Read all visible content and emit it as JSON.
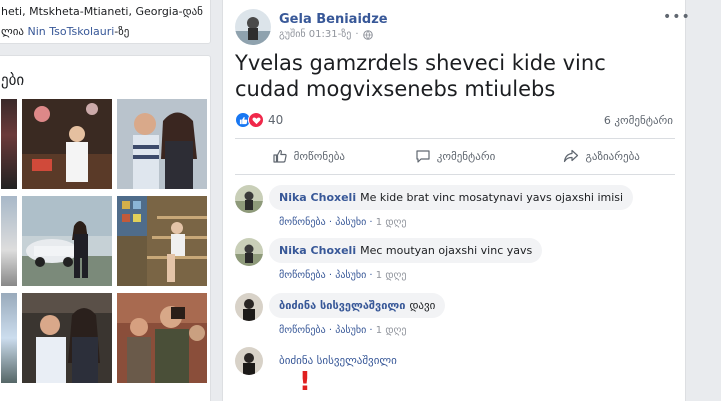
{
  "intro": {
    "line1": "heti, Mtskheta-Mtianeti, Georgia-დან",
    "line2_prefix": "ლია ",
    "line2_link": "Nin TsoTskolauri",
    "line2_suffix": "-ზე"
  },
  "photos": {
    "title": "ები"
  },
  "post": {
    "author": "Gela Beniaidze",
    "time": "გუშინ 01:31-ზე",
    "separator": "·",
    "audience_icon": "globe-icon",
    "more_label": "•••",
    "text": "Yvelas gamzrdels sheveci kide vinc cudad mogvixsenebs mtiulebs",
    "reactions": {
      "icons": [
        "like-icon",
        "love-icon"
      ],
      "count": "40"
    },
    "comments_count": "6 კომენტარი",
    "actions": {
      "like": "მოწონება",
      "comment": "კომენტარი",
      "share": "გაზიარება"
    }
  },
  "comments": [
    {
      "name": "Nika Choxeli",
      "text": "Me kide brat vinc mosatynavi yavs ojaxshi imisi",
      "like": "მოწონება",
      "reply": "პასუხი",
      "time": "1 დღე"
    },
    {
      "name": "Nika Choxeli",
      "text": "Mec moutyan ojaxshi vinc yavs",
      "like": "მოწონება",
      "reply": "პასუხი",
      "time": "1 დღე"
    },
    {
      "name": "ბიძინა სისველაშვილი",
      "text": "დავი",
      "like": "მოწონება",
      "reply": "პასუხი",
      "time": "1 დღე"
    },
    {
      "name": "ბიძინა სისველაშვილი",
      "text": "!"
    }
  ],
  "colors": {
    "link": "#385898",
    "like_blue": "#1877f2",
    "love_red": "#f0284a",
    "background": "#e9ebee"
  }
}
